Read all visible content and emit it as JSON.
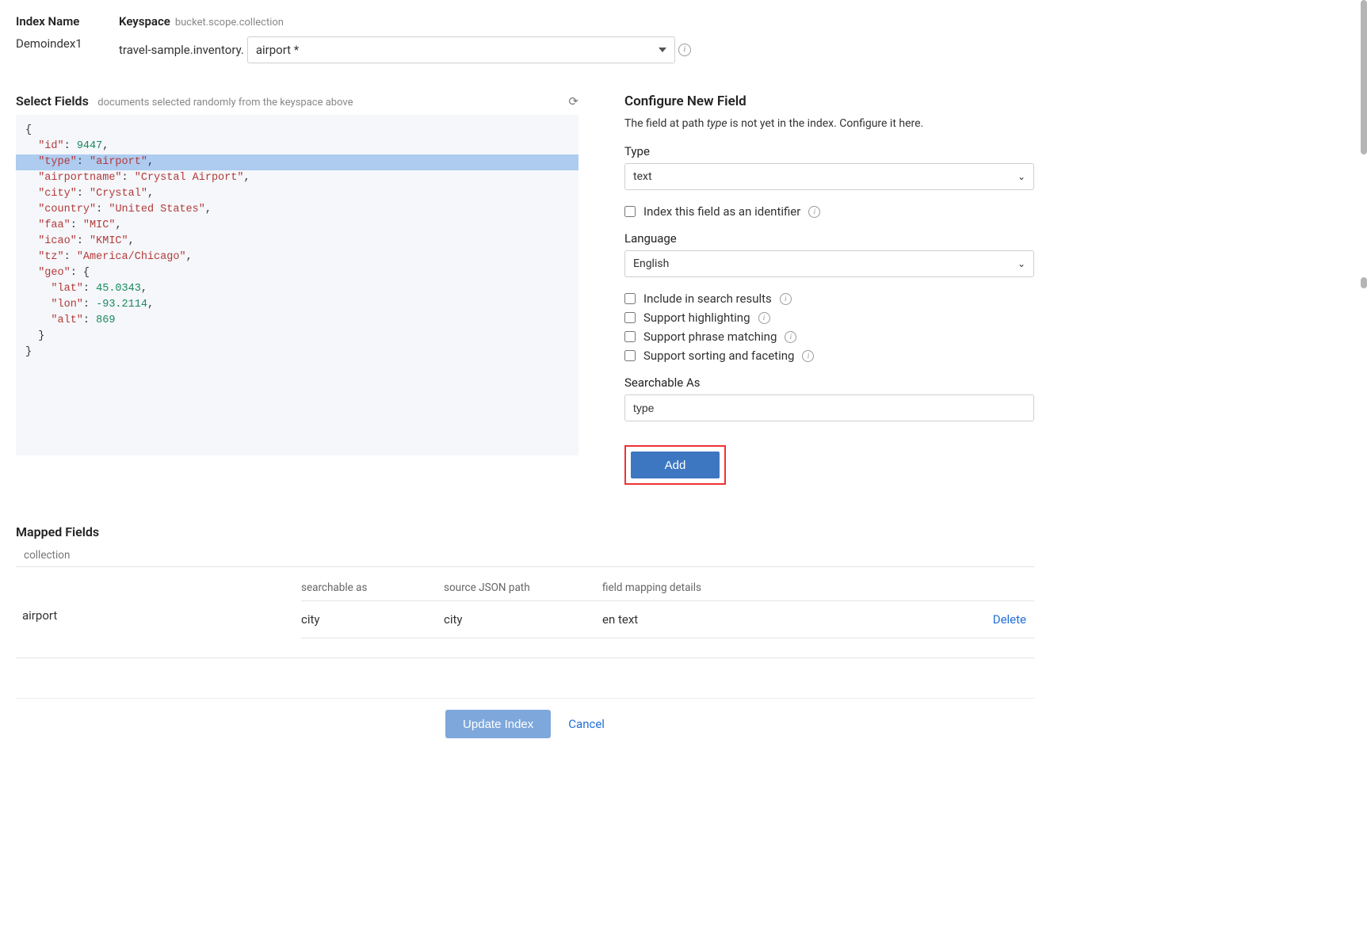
{
  "header": {
    "index_name_label": "Index Name",
    "index_name_value": "Demoindex1",
    "keyspace_label": "Keyspace",
    "keyspace_hint": "bucket.scope.collection",
    "keyspace_prefix": "travel-sample.inventory.",
    "keyspace_value": "airport *"
  },
  "select_fields": {
    "title": "Select Fields",
    "subtitle": "documents selected randomly from the keyspace above",
    "doc": {
      "id": 9447,
      "type": "airport",
      "airportname": "Crystal Airport",
      "city": "Crystal",
      "country": "United States",
      "faa": "MIC",
      "icao": "KMIC",
      "tz": "America/Chicago",
      "geo": {
        "lat": 45.0343,
        "lon": -93.2114,
        "alt": 869
      }
    }
  },
  "configure": {
    "title": "Configure New Field",
    "desc_pre": "The field at path ",
    "desc_path": "type",
    "desc_post": " is not yet in the index. Configure it here.",
    "type_label": "Type",
    "type_value": "text",
    "identifier_label": "Index this field as an identifier",
    "language_label": "Language",
    "language_value": "English",
    "chk_include": "Include in search results",
    "chk_highlight": "Support highlighting",
    "chk_phrase": "Support phrase matching",
    "chk_sort": "Support sorting and faceting",
    "searchable_label": "Searchable As",
    "searchable_value": "type",
    "add_label": "Add"
  },
  "mapped": {
    "title": "Mapped Fields",
    "collection_label": "collection",
    "collection_value": "airport",
    "cols": {
      "c1": "searchable as",
      "c2": "source JSON path",
      "c3": "field mapping details"
    },
    "rows": [
      {
        "searchable_as": "city",
        "source_path": "city",
        "details": "en text",
        "delete": "Delete"
      }
    ]
  },
  "footer": {
    "update": "Update Index",
    "cancel": "Cancel"
  }
}
